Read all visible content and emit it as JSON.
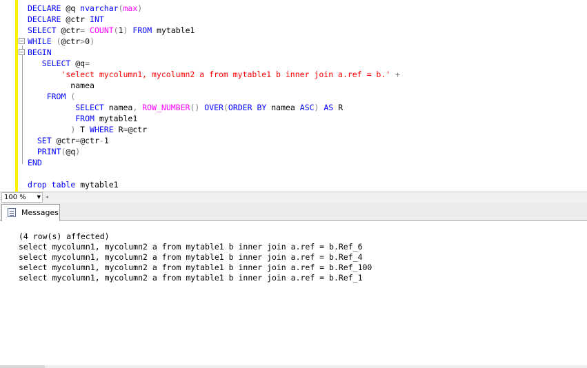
{
  "editor": {
    "lines": [
      [
        {
          "t": "DECLARE",
          "c": "kw"
        },
        {
          "t": " @q ",
          "c": "tx"
        },
        {
          "t": "nvarchar",
          "c": "kw"
        },
        {
          "t": "(",
          "c": "op"
        },
        {
          "t": "max",
          "c": "fn"
        },
        {
          "t": ")",
          "c": "op"
        }
      ],
      [
        {
          "t": "DECLARE",
          "c": "kw"
        },
        {
          "t": " @ctr ",
          "c": "tx"
        },
        {
          "t": "INT",
          "c": "kw"
        }
      ],
      [
        {
          "t": "SELECT",
          "c": "kw"
        },
        {
          "t": " @ctr",
          "c": "tx"
        },
        {
          "t": "=",
          "c": "op"
        },
        {
          "t": " ",
          "c": "tx"
        },
        {
          "t": "COUNT",
          "c": "fn"
        },
        {
          "t": "(",
          "c": "op"
        },
        {
          "t": "1",
          "c": "tx"
        },
        {
          "t": ")",
          "c": "op"
        },
        {
          "t": " ",
          "c": "tx"
        },
        {
          "t": "FROM",
          "c": "kw"
        },
        {
          "t": " mytable1",
          "c": "tx"
        }
      ],
      [
        {
          "t": "WHILE",
          "c": "kw"
        },
        {
          "t": " ",
          "c": "tx"
        },
        {
          "t": "(",
          "c": "op"
        },
        {
          "t": "@ctr",
          "c": "tx"
        },
        {
          "t": ">",
          "c": "op"
        },
        {
          "t": "0",
          "c": "tx"
        },
        {
          "t": ")",
          "c": "op"
        }
      ],
      [
        {
          "t": "BEGIN",
          "c": "kw"
        }
      ],
      [
        {
          "t": "   ",
          "c": "tx"
        },
        {
          "t": "SELECT",
          "c": "kw"
        },
        {
          "t": " @q",
          "c": "tx"
        },
        {
          "t": "=",
          "c": "op"
        }
      ],
      [
        {
          "t": "       ",
          "c": "tx"
        },
        {
          "t": "'select mycolumn1, mycolumn2 a from mytable1 b inner join a.ref = b.'",
          "c": "st"
        },
        {
          "t": " ",
          "c": "tx"
        },
        {
          "t": "+",
          "c": "op"
        }
      ],
      [
        {
          "t": "         namea",
          "c": "tx"
        }
      ],
      [
        {
          "t": "    ",
          "c": "tx"
        },
        {
          "t": "FROM",
          "c": "kw"
        },
        {
          "t": " ",
          "c": "tx"
        },
        {
          "t": "(",
          "c": "op"
        }
      ],
      [
        {
          "t": "          ",
          "c": "tx"
        },
        {
          "t": "SELECT",
          "c": "kw"
        },
        {
          "t": " namea",
          "c": "tx"
        },
        {
          "t": ",",
          "c": "op"
        },
        {
          "t": " ",
          "c": "tx"
        },
        {
          "t": "ROW_NUMBER",
          "c": "fn"
        },
        {
          "t": "()",
          "c": "op"
        },
        {
          "t": " ",
          "c": "tx"
        },
        {
          "t": "OVER",
          "c": "kw"
        },
        {
          "t": "(",
          "c": "op"
        },
        {
          "t": "ORDER BY",
          "c": "kw"
        },
        {
          "t": " namea ",
          "c": "tx"
        },
        {
          "t": "ASC",
          "c": "kw"
        },
        {
          "t": ")",
          "c": "op"
        },
        {
          "t": " ",
          "c": "tx"
        },
        {
          "t": "AS",
          "c": "kw"
        },
        {
          "t": " R",
          "c": "tx"
        }
      ],
      [
        {
          "t": "          ",
          "c": "tx"
        },
        {
          "t": "FROM",
          "c": "kw"
        },
        {
          "t": " mytable1",
          "c": "tx"
        }
      ],
      [
        {
          "t": "         ",
          "c": "tx"
        },
        {
          "t": ")",
          "c": "op"
        },
        {
          "t": " T ",
          "c": "tx"
        },
        {
          "t": "WHERE",
          "c": "kw"
        },
        {
          "t": " R",
          "c": "tx"
        },
        {
          "t": "=",
          "c": "op"
        },
        {
          "t": "@ctr",
          "c": "tx"
        }
      ],
      [
        {
          "t": "  ",
          "c": "tx"
        },
        {
          "t": "SET",
          "c": "kw"
        },
        {
          "t": " @ctr",
          "c": "tx"
        },
        {
          "t": "=",
          "c": "op"
        },
        {
          "t": "@ctr",
          "c": "tx"
        },
        {
          "t": "-",
          "c": "op"
        },
        {
          "t": "1",
          "c": "tx"
        }
      ],
      [
        {
          "t": "  ",
          "c": "tx"
        },
        {
          "t": "PRINT",
          "c": "kw"
        },
        {
          "t": "(",
          "c": "op"
        },
        {
          "t": "@q",
          "c": "tx"
        },
        {
          "t": ")",
          "c": "op"
        }
      ],
      [
        {
          "t": "END",
          "c": "kw"
        }
      ],
      [],
      [
        {
          "t": "drop",
          "c": "kw"
        },
        {
          "t": " ",
          "c": "tx"
        },
        {
          "t": "table",
          "c": "kw"
        },
        {
          "t": " mytable1",
          "c": "tx"
        }
      ]
    ],
    "collapse_markers": [
      "−",
      "−"
    ],
    "colors": {
      "kw": "#0000ff",
      "fn": "#ff00ff",
      "st": "#ff0000",
      "op": "#808080",
      "tx": "#000000",
      "change_bar": "#fff200"
    }
  },
  "zoom": {
    "value": "100 %",
    "arrow_icon": "chevron-down-icon",
    "scroll_left_icon": "scroll-left-icon"
  },
  "messages": {
    "tab_label": "Messages",
    "tab_icon": "messages-icon",
    "lines": [
      "(4 row(s) affected)",
      "select mycolumn1, mycolumn2 a from mytable1 b inner join a.ref = b.Ref_6",
      "select mycolumn1, mycolumn2 a from mytable1 b inner join a.ref = b.Ref_4",
      "select mycolumn1, mycolumn2 a from mytable1 b inner join a.ref = b.Ref_100",
      "select mycolumn1, mycolumn2 a from mytable1 b inner join a.ref = b.Ref_1"
    ]
  }
}
